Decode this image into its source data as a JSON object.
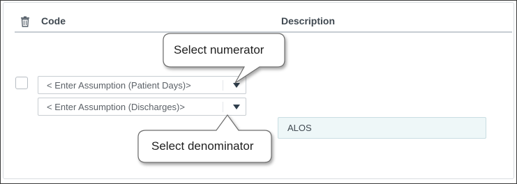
{
  "table": {
    "headers": {
      "delete_icon": "trash-icon",
      "code": "Code",
      "description": "Description"
    },
    "row": {
      "numerator_select": {
        "value": "< Enter Assumption (Patient Days)>"
      },
      "denominator_select": {
        "value": "< Enter Assumption (Discharges)>"
      },
      "description_value": "ALOS"
    }
  },
  "callouts": {
    "numerator": "Select numerator",
    "denominator": "Select denominator"
  },
  "colors": {
    "header_text": "#3f4850",
    "arrow": "#2f3e4c",
    "description_bg": "#eef7f8"
  }
}
